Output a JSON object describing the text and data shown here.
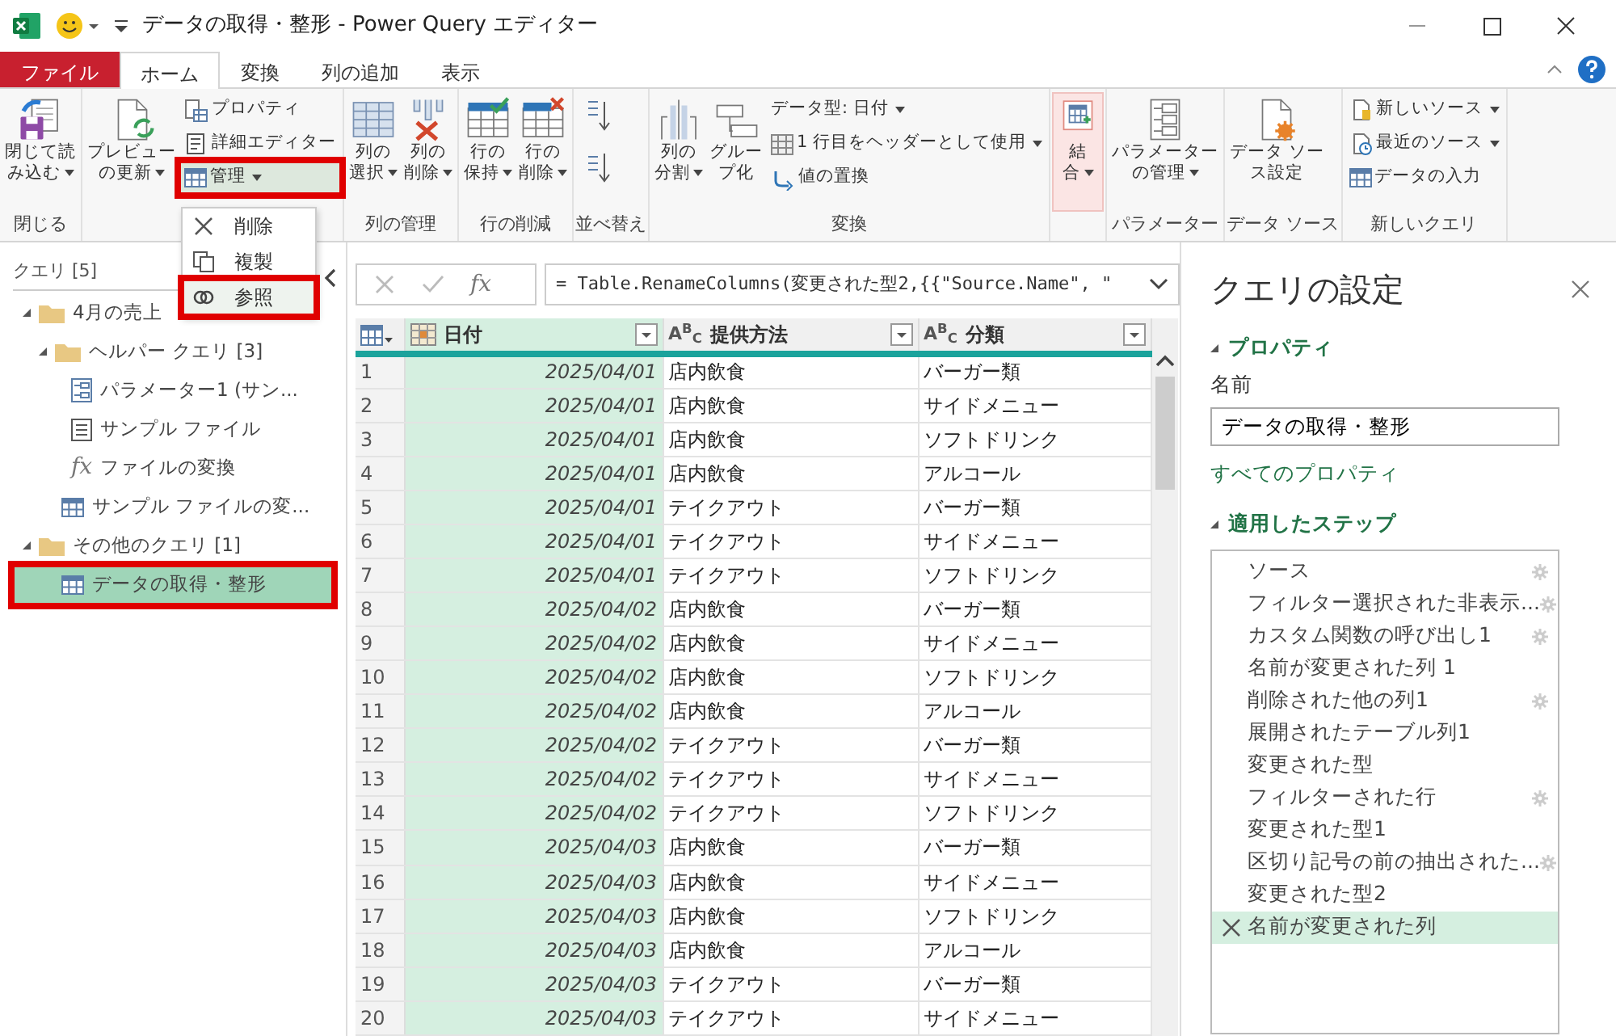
{
  "window": {
    "title": "データの取得・整形 - Power Query エディター"
  },
  "tabs": [
    {
      "label": "ファイル",
      "kind": "file",
      "selected": false
    },
    {
      "label": "ホーム",
      "kind": "tab",
      "selected": true
    },
    {
      "label": "変換",
      "kind": "tab",
      "selected": false
    },
    {
      "label": "列の追加",
      "kind": "tab",
      "selected": false
    },
    {
      "label": "表示",
      "kind": "tab",
      "selected": false
    }
  ],
  "ribbon": {
    "groups": [
      {
        "label": "閉じる",
        "items": [
          {
            "kind": "large",
            "lines": [
              "閉じて読",
              "み込む"
            ],
            "dropdown": true
          }
        ]
      },
      {
        "items": [
          {
            "kind": "large",
            "lines": [
              "プレビュー",
              "の更新"
            ],
            "dropdown": true
          },
          {
            "kind": "stack",
            "items": [
              {
                "label": "プロパティ",
                "dropdown": false,
                "highlighted": false
              },
              {
                "label": "詳細エディター",
                "dropdown": false,
                "highlighted": false
              },
              {
                "label": "管理",
                "dropdown": true,
                "highlighted": true
              }
            ]
          }
        ]
      },
      {
        "label": "列の管理",
        "items": [
          {
            "kind": "large",
            "lines": [
              "列の",
              "選択"
            ],
            "dropdown": true
          },
          {
            "kind": "large",
            "lines": [
              "列の",
              "削除"
            ],
            "dropdown": true
          }
        ]
      },
      {
        "label": "行の削減",
        "items": [
          {
            "kind": "large",
            "lines": [
              "行の",
              "保持"
            ],
            "dropdown": true
          },
          {
            "kind": "large",
            "lines": [
              "行の",
              "削除"
            ],
            "dropdown": true
          }
        ]
      },
      {
        "label": "並べ替え",
        "items": [
          {
            "kind": "sort"
          }
        ]
      },
      {
        "label": "変換",
        "items": [
          {
            "kind": "large",
            "lines": [
              "列の",
              "分割"
            ],
            "dropdown": true
          },
          {
            "kind": "large",
            "lines": [
              "グルー",
              "プ化"
            ],
            "dropdown": false
          },
          {
            "kind": "stack",
            "items": [
              {
                "label": "データ型: 日付",
                "dropdown": true,
                "highlighted": false,
                "icon": false
              },
              {
                "label": "1 行目をヘッダーとして使用",
                "dropdown": true,
                "highlighted": false,
                "icon": true
              },
              {
                "label": "値の置換",
                "dropdown": false,
                "highlighted": false,
                "icon": true
              }
            ]
          }
        ]
      },
      {
        "items": [
          {
            "kind": "large",
            "lines": [
              "結",
              "合"
            ],
            "dropdown": true,
            "pressed": true
          }
        ]
      },
      {
        "label": "パラメーター",
        "items": [
          {
            "kind": "large",
            "lines": [
              "パラメーター",
              "の管理"
            ],
            "dropdown": true
          }
        ]
      },
      {
        "label": "データ ソース",
        "items": [
          {
            "kind": "large",
            "lines": [
              "データ ソー",
              "ス設定"
            ],
            "dropdown": false
          }
        ]
      },
      {
        "label": "新しいクエリ",
        "items": [
          {
            "kind": "stack",
            "items": [
              {
                "label": "新しいソース",
                "dropdown": true,
                "highlighted": false
              },
              {
                "label": "最近のソース",
                "dropdown": true,
                "highlighted": false
              },
              {
                "label": "データの入力",
                "dropdown": false,
                "highlighted": false
              }
            ]
          }
        ]
      }
    ]
  },
  "manage_menu": {
    "items": [
      {
        "label": "削除",
        "highlighted": false
      },
      {
        "label": "複製",
        "highlighted": false
      },
      {
        "label": "参照",
        "highlighted": true
      }
    ]
  },
  "queries": {
    "title": "クエリ [5]",
    "tree": [
      {
        "label": "4月の売上",
        "kind": "folder",
        "expanded": true,
        "selected": false,
        "highlighted": false,
        "children": [
          {
            "label": "ヘルパー クエリ [3]",
            "kind": "folder",
            "expanded": true,
            "selected": false,
            "highlighted": false,
            "children": [
              {
                "label": "パラメーター1 (サン...",
                "kind": "parameter",
                "selected": false,
                "highlighted": false
              },
              {
                "label": "サンプル ファイル",
                "kind": "list",
                "selected": false,
                "highlighted": false
              },
              {
                "label": "ファイルの変換",
                "kind": "function",
                "icon_text": "fx",
                "selected": false,
                "highlighted": false
              }
            ]
          },
          {
            "label": "サンプル ファイルの変...",
            "kind": "table",
            "selected": false,
            "highlighted": false
          }
        ]
      },
      {
        "label": "その他のクエリ [1]",
        "kind": "folder",
        "expanded": true,
        "selected": false,
        "highlighted": false,
        "children": [
          {
            "label": "データの取得・整形",
            "kind": "table",
            "selected": true,
            "highlighted": true
          }
        ]
      }
    ]
  },
  "formula_bar": {
    "fx": "fx",
    "formula": "= Table.RenameColumns(変更された型2,{{\"Source.Name\", \""
  },
  "table": {
    "columns": [
      {
        "label": "日付",
        "kind": "date",
        "selected": true
      },
      {
        "label": "提供方法",
        "kind": "text",
        "type_label": "A$^{B}$$_{C}$",
        "selected": false
      },
      {
        "label": "分類",
        "kind": "text",
        "type_label": "A$^{B}$$_{C}$",
        "selected": false
      }
    ],
    "rows": [
      {
        "row_number": "1",
        "cells": [
          "2025/04/01",
          "店内飲食",
          "バーガー類"
        ]
      },
      {
        "row_number": "2",
        "cells": [
          "2025/04/01",
          "店内飲食",
          "サイドメニュー"
        ]
      },
      {
        "row_number": "3",
        "cells": [
          "2025/04/01",
          "店内飲食",
          "ソフトドリンク"
        ]
      },
      {
        "row_number": "4",
        "cells": [
          "2025/04/01",
          "店内飲食",
          "アルコール"
        ]
      },
      {
        "row_number": "5",
        "cells": [
          "2025/04/01",
          "テイクアウト",
          "バーガー類"
        ]
      },
      {
        "row_number": "6",
        "cells": [
          "2025/04/01",
          "テイクアウト",
          "サイドメニュー"
        ]
      },
      {
        "row_number": "7",
        "cells": [
          "2025/04/01",
          "テイクアウト",
          "ソフトドリンク"
        ]
      },
      {
        "row_number": "8",
        "cells": [
          "2025/04/02",
          "店内飲食",
          "バーガー類"
        ]
      },
      {
        "row_number": "9",
        "cells": [
          "2025/04/02",
          "店内飲食",
          "サイドメニュー"
        ]
      },
      {
        "row_number": "10",
        "cells": [
          "2025/04/02",
          "店内飲食",
          "ソフトドリンク"
        ]
      },
      {
        "row_number": "11",
        "cells": [
          "2025/04/02",
          "店内飲食",
          "アルコール"
        ]
      },
      {
        "row_number": "12",
        "cells": [
          "2025/04/02",
          "テイクアウト",
          "バーガー類"
        ]
      },
      {
        "row_number": "13",
        "cells": [
          "2025/04/02",
          "テイクアウト",
          "サイドメニュー"
        ]
      },
      {
        "row_number": "14",
        "cells": [
          "2025/04/02",
          "テイクアウト",
          "ソフトドリンク"
        ]
      },
      {
        "row_number": "15",
        "cells": [
          "2025/04/03",
          "店内飲食",
          "バーガー類"
        ]
      },
      {
        "row_number": "16",
        "cells": [
          "2025/04/03",
          "店内飲食",
          "サイドメニュー"
        ]
      },
      {
        "row_number": "17",
        "cells": [
          "2025/04/03",
          "店内飲食",
          "ソフトドリンク"
        ]
      },
      {
        "row_number": "18",
        "cells": [
          "2025/04/03",
          "店内飲食",
          "アルコール"
        ]
      },
      {
        "row_number": "19",
        "cells": [
          "2025/04/03",
          "テイクアウト",
          "バーガー類"
        ]
      },
      {
        "row_number": "20",
        "cells": [
          "2025/04/03",
          "テイクアウト",
          "サイドメニュー"
        ]
      }
    ]
  },
  "settings": {
    "title": "クエリの設定",
    "properties_heading": "プロパティ",
    "name_label": "名前",
    "name_value": "データの取得・整形",
    "all_properties": "すべてのプロパティ",
    "steps_heading": "適用したステップ",
    "steps": [
      {
        "label": "ソース",
        "settings": true,
        "selected": false
      },
      {
        "label": "フィルター選択された非表示...",
        "settings": true,
        "selected": false
      },
      {
        "label": "カスタム関数の呼び出し1",
        "settings": true,
        "selected": false
      },
      {
        "label": "名前が変更された列 1",
        "settings": false,
        "selected": false
      },
      {
        "label": "削除された他の列1",
        "settings": true,
        "selected": false
      },
      {
        "label": "展開されたテーブル列1",
        "settings": false,
        "selected": false
      },
      {
        "label": "変更された型",
        "settings": false,
        "selected": false
      },
      {
        "label": "フィルターされた行",
        "settings": true,
        "selected": false
      },
      {
        "label": "変更された型1",
        "settings": false,
        "selected": false
      },
      {
        "label": "区切り記号の前の抽出された...",
        "settings": true,
        "selected": false
      },
      {
        "label": "変更された型2",
        "settings": false,
        "selected": false
      },
      {
        "label": "名前が変更された列",
        "settings": false,
        "selected": true
      }
    ]
  }
}
